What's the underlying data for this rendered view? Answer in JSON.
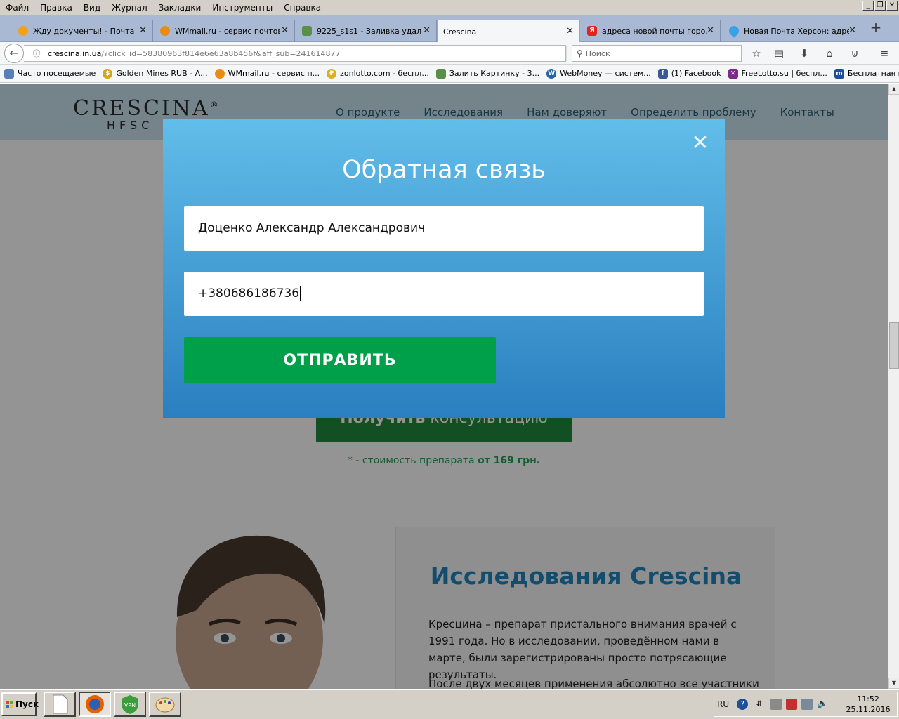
{
  "menu": [
    "Файл",
    "Правка",
    "Вид",
    "Журнал",
    "Закладки",
    "Инструменты",
    "Справка"
  ],
  "tabs": [
    {
      "title": "Жду документы! - Почта ...",
      "icon": "mail-icon",
      "color": "#f0a21e"
    },
    {
      "title": "WMmail.ru - сервис почтов...",
      "icon": "wmmail-icon",
      "color": "#e88c17"
    },
    {
      "title": "9225_s1s1 - Заливка удал...",
      "icon": "image-icon",
      "color": "#5a8f4b"
    },
    {
      "title": "Crescina",
      "icon": "page-icon",
      "color": "#ffffff",
      "active": true
    },
    {
      "title": "адреса новой почты горо...",
      "icon": "yandex-icon",
      "color": "#e32323"
    },
    {
      "title": "Новая Почта Херсон: адре...",
      "icon": "map-pin-icon",
      "color": "#3aa1e4"
    }
  ],
  "nav": {
    "url_domain": "crescina.in.ua",
    "url_rest": "/?click_id=58380963f814e6e63a8b456f&aff_sub=241614877",
    "search_placeholder": "Поиск"
  },
  "bookmarks": [
    {
      "label": "Часто посещаемые",
      "icon": "bookmarks-folder-icon",
      "color": "#5a7fb8"
    },
    {
      "label": "Golden Mines RUB - А...",
      "icon": "coin-icon",
      "color": "#d8a21b"
    },
    {
      "label": "WMmail.ru - сервис п...",
      "icon": "wmmail-icon",
      "color": "#e88c17"
    },
    {
      "label": "zonlotto.com - беспл...",
      "icon": "coin-icon",
      "color": "#e0b01c"
    },
    {
      "label": "Залить Картинку - 3...",
      "icon": "image-icon",
      "color": "#5a8f4b"
    },
    {
      "label": "WebMoney — систем...",
      "icon": "webmoney-icon",
      "color": "#2563a8"
    },
    {
      "label": "(1) Facebook",
      "icon": "facebook-icon",
      "color": "#3b5998"
    },
    {
      "label": "FreeLotto.su | беспл...",
      "icon": "freelotto-icon",
      "color": "#7a2a8a"
    },
    {
      "label": "Бесплатная консуль...",
      "icon": "consult-icon",
      "color": "#1f4f99"
    }
  ],
  "site": {
    "logo_main": "CRESCINA",
    "logo_reg": "®",
    "logo_sub": "HFSC",
    "nav": [
      "О продукте",
      "Исследования",
      "Нам доверяют",
      "Определить проблему",
      "Контакты"
    ],
    "cta_bold": "Получить",
    "cta_rest": " консультацию",
    "price_prefix": "* - стоимость препарата ",
    "price_bold": "от 169 грн.",
    "research_title": "Исследования Crescina",
    "research_text": "Кресцина – препарат пристального внимания врачей с 1991 года. Но в исследовании, проведённом нами в марте, были зарегистрированы просто потрясающие результаты.",
    "research_text2": "После двух месяцев применения абсолютно все участники"
  },
  "modal": {
    "title": "Обратная связь",
    "name_value": "Доценко Александр Александрович",
    "phone_value": "+380686186736",
    "submit_label": "ОТПРАВИТЬ"
  },
  "taskbar": {
    "start_label": "Пуск",
    "lang": "RU",
    "time": "11:52",
    "date": "25.11.2016"
  }
}
